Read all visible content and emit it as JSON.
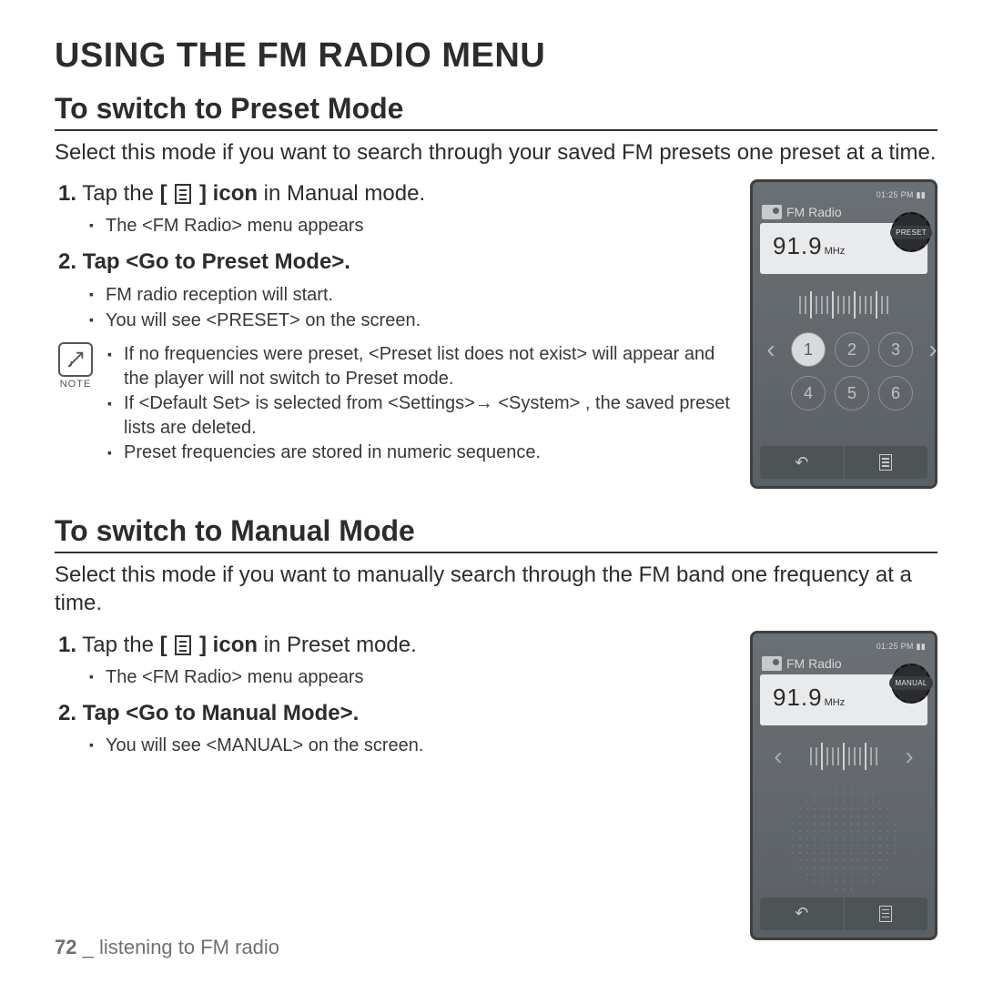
{
  "title": "USING THE FM RADIO MENU",
  "sections": [
    {
      "heading": "To switch to Preset Mode",
      "intro": "Select this mode if you want to search through your saved FM presets one preset at a time.",
      "steps": [
        {
          "n": "1.",
          "pre": "Tap the ",
          "iconbold": "icon",
          "post": " in Manual mode.",
          "bullets": [
            "The <FM Radio> menu appears"
          ]
        },
        {
          "n": "2.",
          "bold": "Tap <Go to Preset Mode>.",
          "bullets": [
            "FM radio reception will start.",
            "You will see <PRESET> on the screen."
          ]
        }
      ],
      "note_label": "NOTE",
      "notes": [
        "If no frequencies were preset, <Preset list does not exist> will appear and the player will not switch to Preset mode.",
        "If <Default Set> is selected from <Settings>→ <System> , the saved preset lists are deleted.",
        "Preset frequencies are stored in numeric sequence."
      ],
      "device": {
        "status": "01:25 PM",
        "app": "FM Radio",
        "freq": "91.9",
        "unit": "MHz",
        "mode": "PRESET",
        "presets": [
          "1",
          "2",
          "3",
          "4",
          "5",
          "6"
        ],
        "layout": "preset"
      }
    },
    {
      "heading": "To switch to Manual Mode",
      "intro": "Select this mode if you want to manually search through the FM band one frequency at a time.",
      "steps": [
        {
          "n": "1.",
          "pre": "Tap the ",
          "iconbold": "icon",
          "post": " in Preset mode.",
          "bullets": [
            "The <FM Radio> menu appears"
          ]
        },
        {
          "n": "2.",
          "bold": "Tap <Go to Manual Mode>.",
          "bullets": [
            "You will see <MANUAL> on the screen."
          ]
        }
      ],
      "device": {
        "status": "01:25 PM",
        "app": "FM Radio",
        "freq": "91.9",
        "unit": "MHz",
        "mode": "MANUAL",
        "layout": "manual"
      }
    }
  ],
  "footer": {
    "page": "72",
    "sep": " _ ",
    "chapter": "listening to FM radio"
  }
}
